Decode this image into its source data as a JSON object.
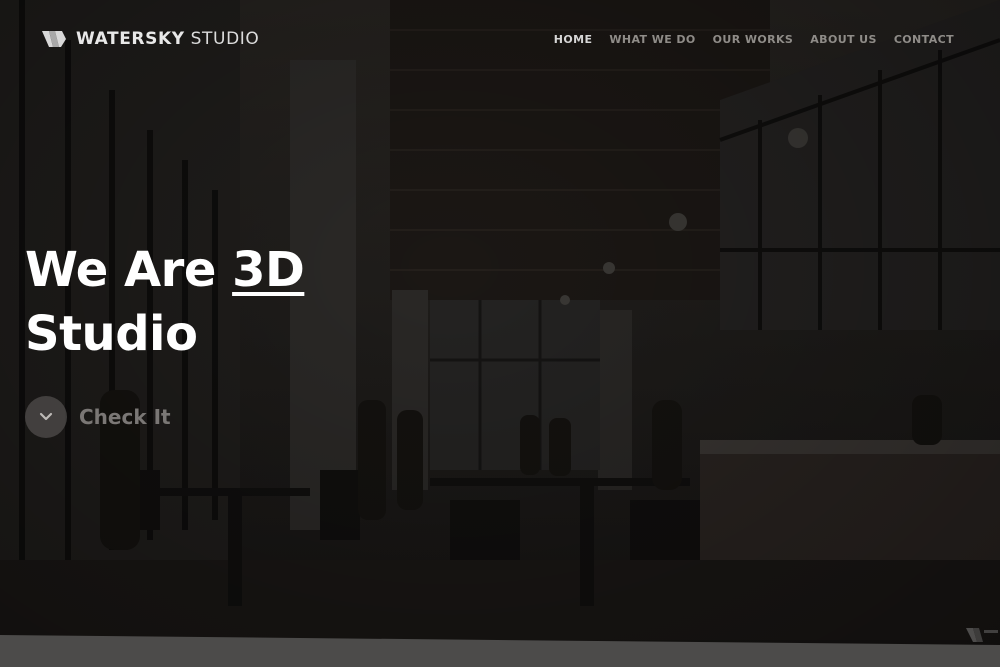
{
  "brand": {
    "name_bold": "WATERSKY",
    "name_light": "STUDIO",
    "icon": "watersky-logo-icon"
  },
  "nav": {
    "items": [
      {
        "label": "HOME",
        "active": true
      },
      {
        "label": "WHAT WE DO",
        "active": false
      },
      {
        "label": "OUR WORKS",
        "active": false
      },
      {
        "label": "ABOUT US",
        "active": false
      },
      {
        "label": "CONTACT",
        "active": false
      }
    ]
  },
  "hero": {
    "title_prefix": "We Are",
    "title_highlight": "3D",
    "title_line2": "Studio",
    "cta_label": "Check It",
    "cta_icon": "chevron-down-icon"
  },
  "colors": {
    "overlay": "#1d1b19",
    "nav_active": "#d6d6d6",
    "nav_inactive": "#8f8c88",
    "title": "#ffffff",
    "cta_text": "#7a7775",
    "bottom_band": "#4c4b4a"
  }
}
